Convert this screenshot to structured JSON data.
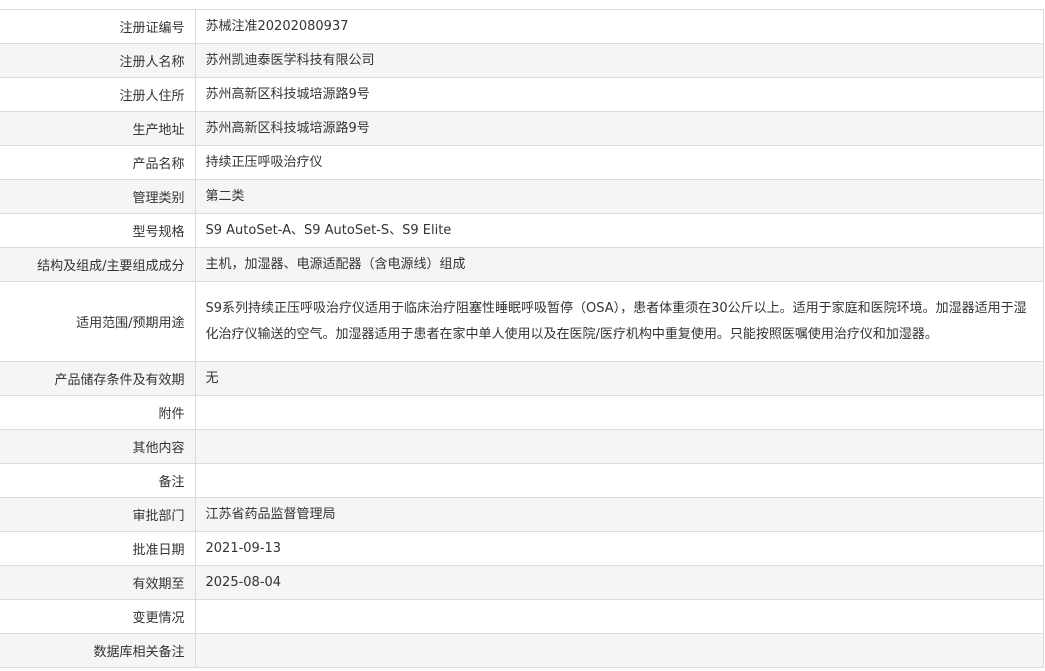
{
  "rows": [
    {
      "label": "注册证编号",
      "value": "苏械注准20202080937"
    },
    {
      "label": "注册人名称",
      "value": "苏州凯迪泰医学科技有限公司"
    },
    {
      "label": "注册人住所",
      "value": "苏州高新区科技城培源路9号"
    },
    {
      "label": "生产地址",
      "value": "苏州高新区科技城培源路9号"
    },
    {
      "label": "产品名称",
      "value": "持续正压呼吸治疗仪"
    },
    {
      "label": "管理类别",
      "value": "第二类"
    },
    {
      "label": "型号规格",
      "value": "S9 AutoSet-A、S9 AutoSet-S、S9 Elite"
    },
    {
      "label": "结构及组成/主要组成成分",
      "value": "主机，加湿器、电源适配器（含电源线）组成"
    },
    {
      "label": "适用范围/预期用途",
      "value": "S9系列持续正压呼吸治疗仪适用于临床治疗阻塞性睡眠呼吸暂停（OSA），患者体重须在30公斤以上。适用于家庭和医院环境。加湿器适用于湿化治疗仪输送的空气。加湿器适用于患者在家中单人使用以及在医院/医疗机构中重复使用。只能按照医嘱使用治疗仪和加湿器。"
    },
    {
      "label": "产品储存条件及有效期",
      "value": "无"
    },
    {
      "label": "附件",
      "value": ""
    },
    {
      "label": "其他内容",
      "value": ""
    },
    {
      "label": "备注",
      "value": ""
    },
    {
      "label": "审批部门",
      "value": "江苏省药品监督管理局"
    },
    {
      "label": "批准日期",
      "value": "2021-09-13"
    },
    {
      "label": "有效期至",
      "value": "2025-08-04"
    },
    {
      "label": "变更情况",
      "value": ""
    },
    {
      "label": "数据库相关备注",
      "value": ""
    }
  ]
}
